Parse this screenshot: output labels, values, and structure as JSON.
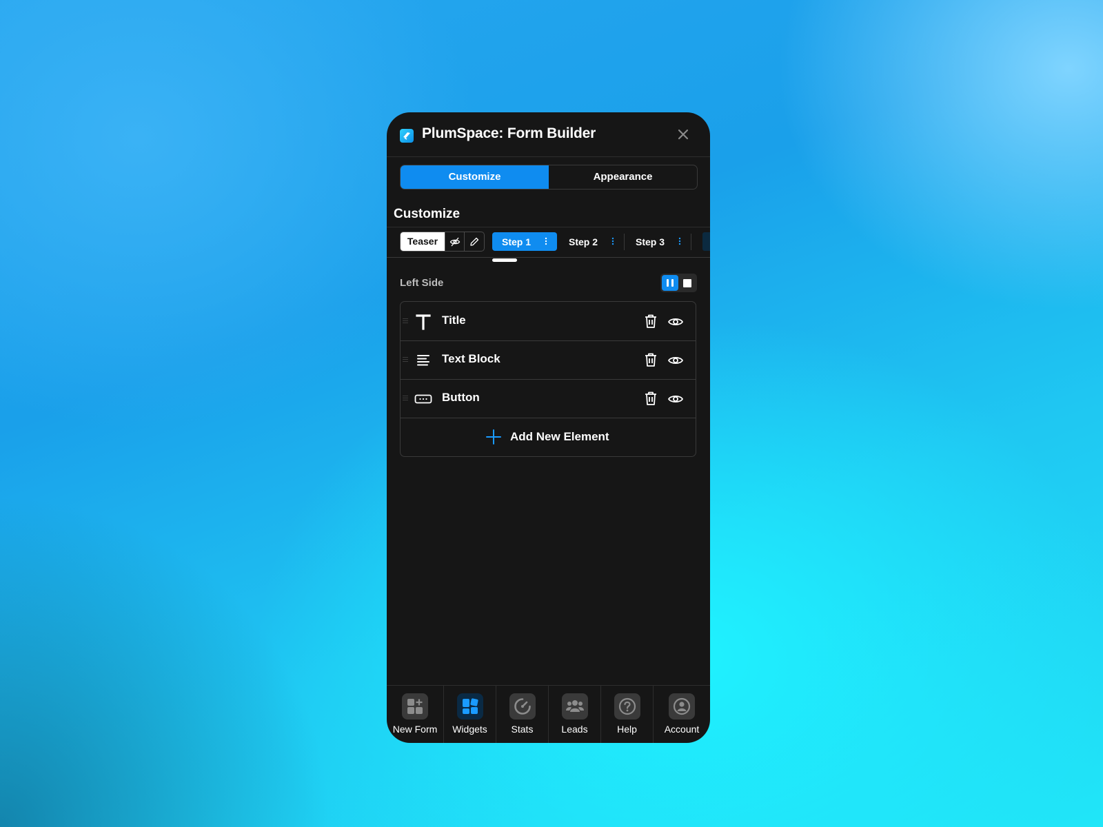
{
  "window": {
    "title": "PlumSpace: Form Builder"
  },
  "segmented": {
    "customize": "Customize",
    "appearance": "Appearance"
  },
  "section": {
    "title": "Customize"
  },
  "teaser": {
    "label": "Teaser"
  },
  "steps": [
    {
      "label": "Step 1",
      "active": true
    },
    {
      "label": "Step 2",
      "active": false
    },
    {
      "label": "Step 3",
      "active": false
    }
  ],
  "side": {
    "label": "Left Side"
  },
  "elements": [
    {
      "label": "Title",
      "icon": "title-T-icon"
    },
    {
      "label": "Text Block",
      "icon": "text-align-icon"
    },
    {
      "label": "Button",
      "icon": "button-icon"
    }
  ],
  "add_element": {
    "label": "Add New Element"
  },
  "nav": [
    {
      "label": "New Form",
      "icon": "new-form-icon",
      "active": false
    },
    {
      "label": "Widgets",
      "icon": "widgets-icon",
      "active": true
    },
    {
      "label": "Stats",
      "icon": "stats-gauge-icon",
      "active": false
    },
    {
      "label": "Leads",
      "icon": "leads-people-icon",
      "active": false
    },
    {
      "label": "Help",
      "icon": "help-icon",
      "active": false
    },
    {
      "label": "Account",
      "icon": "account-icon",
      "active": false
    }
  ],
  "colors": {
    "accent": "#0f8cf0",
    "panel": "#161616",
    "border": "#3a3a3a"
  }
}
